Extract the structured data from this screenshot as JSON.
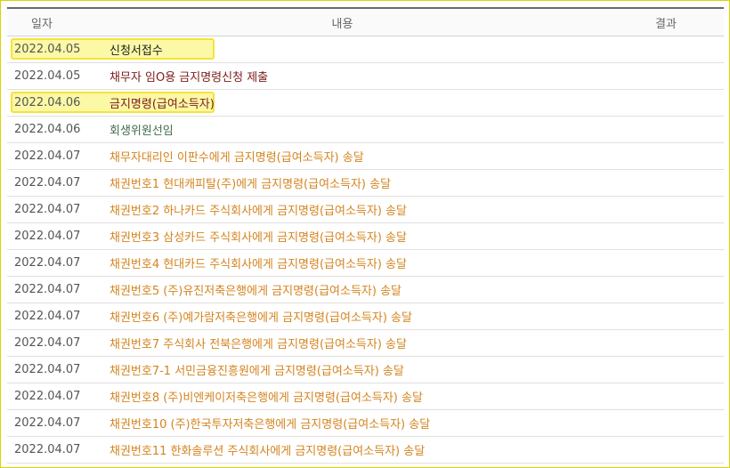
{
  "header": {
    "date": "일자",
    "content": "내용",
    "result": "결과"
  },
  "colors": {
    "black": "#222222",
    "maroon": "#7a1c1c",
    "green": "#3f6b4f",
    "orange": "#d4841f"
  },
  "rows": [
    {
      "date": "2022.04.05",
      "content": "신청서접수",
      "color": "#222222",
      "highlight": true
    },
    {
      "date": "2022.04.05",
      "content": "채무자 임O용 금지명령신청 제출",
      "color": "#7a1c1c",
      "highlight": false
    },
    {
      "date": "2022.04.06",
      "content": "금지명령(급여소득자)",
      "color": "#7a1c1c",
      "highlight": true
    },
    {
      "date": "2022.04.06",
      "content": "회생위원선임",
      "color": "#3f6b4f",
      "highlight": false
    },
    {
      "date": "2022.04.07",
      "content": "채무자대리인 이판수에게 금지명령(급여소득자) 송달",
      "color": "#d4841f",
      "highlight": false
    },
    {
      "date": "2022.04.07",
      "content": "채권번호1 현대캐피탈(주)에게 금지명령(급여소득자) 송달",
      "color": "#d4841f",
      "highlight": false
    },
    {
      "date": "2022.04.07",
      "content": "채권번호2 하나카드 주식회사에게 금지명령(급여소득자) 송달",
      "color": "#d4841f",
      "highlight": false
    },
    {
      "date": "2022.04.07",
      "content": "채권번호3 삼성카드 주식회사에게 금지명령(급여소득자) 송달",
      "color": "#d4841f",
      "highlight": false
    },
    {
      "date": "2022.04.07",
      "content": "채권번호4 현대카드 주식회사에게 금지명령(급여소득자) 송달",
      "color": "#d4841f",
      "highlight": false
    },
    {
      "date": "2022.04.07",
      "content": "채권번호5 (주)유진저축은행에게 금지명령(급여소득자) 송달",
      "color": "#d4841f",
      "highlight": false
    },
    {
      "date": "2022.04.07",
      "content": "채권번호6 (주)예가람저축은행에게 금지명령(급여소득자) 송달",
      "color": "#d4841f",
      "highlight": false
    },
    {
      "date": "2022.04.07",
      "content": "채권번호7 주식회사 전북은행에게 금지명령(급여소득자) 송달",
      "color": "#d4841f",
      "highlight": false
    },
    {
      "date": "2022.04.07",
      "content": "채권번호7-1 서민금융진흥원에게 금지명령(급여소득자) 송달",
      "color": "#d4841f",
      "highlight": false
    },
    {
      "date": "2022.04.07",
      "content": "채권번호8 (주)비엔케이저축은행에게 금지명령(급여소득자) 송달",
      "color": "#d4841f",
      "highlight": false
    },
    {
      "date": "2022.04.07",
      "content": "채권번호10 (주)한국투자저축은행에게 금지명령(급여소득자) 송달",
      "color": "#d4841f",
      "highlight": false
    },
    {
      "date": "2022.04.07",
      "content": "채권번호11 한화솔루션 주식회사에게 금지명령(급여소득자) 송달",
      "color": "#d4841f",
      "highlight": false
    }
  ]
}
